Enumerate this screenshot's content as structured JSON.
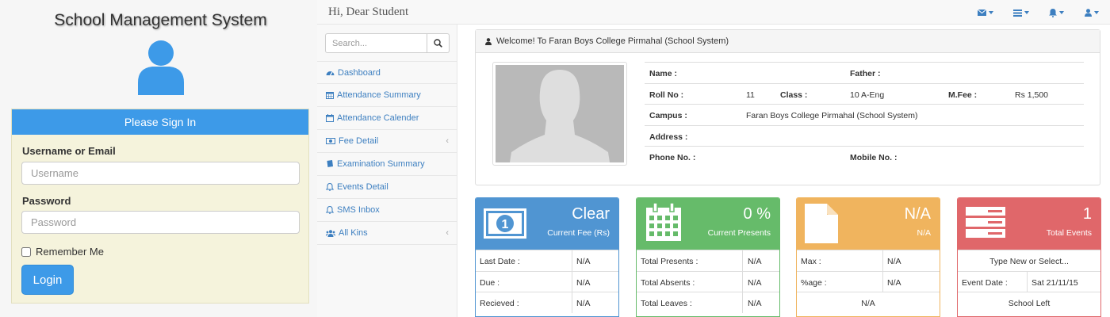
{
  "login": {
    "system_title": "School Management System",
    "panel_title": "Please Sign In",
    "username_label": "Username or Email",
    "username_placeholder": "Username",
    "password_label": "Password",
    "password_placeholder": "Password",
    "remember_label": "Remember Me",
    "login_button": "Login"
  },
  "topbar": {
    "greeting": "Hi, Dear Student",
    "icons": [
      "envelope-icon",
      "tasks-icon",
      "bell-icon",
      "user-icon"
    ]
  },
  "sidebar": {
    "search_placeholder": "Search...",
    "items": [
      {
        "label": "Dashboard",
        "icon": "dashboard-icon",
        "has_submenu": false
      },
      {
        "label": "Attendance Summary",
        "icon": "calendar-icon",
        "has_submenu": false
      },
      {
        "label": "Attendance Calender",
        "icon": "calendar-icon",
        "has_submenu": false
      },
      {
        "label": "Fee Detail",
        "icon": "money-icon",
        "has_submenu": true
      },
      {
        "label": "Examination Summary",
        "icon": "book-icon",
        "has_submenu": false
      },
      {
        "label": "Events Detail",
        "icon": "bell-icon",
        "has_submenu": false
      },
      {
        "label": "SMS Inbox",
        "icon": "bell-icon",
        "has_submenu": false
      },
      {
        "label": "All Kins",
        "icon": "users-icon",
        "has_submenu": true
      }
    ]
  },
  "welcome": {
    "heading": "Welcome! To Faran Boys College Pirmahal (School System)",
    "name_label": "Name :",
    "name_value": "",
    "father_label": "Father :",
    "father_value": "",
    "rollno_label": "Roll No :",
    "rollno_value": "11",
    "class_label": "Class :",
    "class_value": "10 A-Eng",
    "mfee_label": "M.Fee :",
    "mfee_value": "Rs 1,500",
    "campus_label": "Campus :",
    "campus_value": "Faran Boys College Pirmahal (School System)",
    "address_label": "Address :",
    "address_value": "",
    "phone_label": "Phone No. :",
    "phone_value": "",
    "mobile_label": "Mobile No. :",
    "mobile_value": ""
  },
  "cards": {
    "fee": {
      "color": "#5095d2",
      "big": "Clear",
      "sub": "Current Fee (Rs)",
      "rows": [
        {
          "label": "Last Date :",
          "value": "N/A"
        },
        {
          "label": "Due :",
          "value": "N/A"
        },
        {
          "label": "Recieved :",
          "value": "N/A"
        }
      ]
    },
    "attendance": {
      "color": "#66bb6a",
      "big": "0 %",
      "sub": "Current Presents",
      "rows": [
        {
          "label": "Total Presents :",
          "value": "N/A"
        },
        {
          "label": "Total Absents :",
          "value": "N/A"
        },
        {
          "label": "Total Leaves :",
          "value": "N/A"
        }
      ]
    },
    "exam": {
      "color": "#f0b45e",
      "big": "N/A",
      "sub": "N/A",
      "rows": [
        {
          "label": "Max :",
          "value": "N/A"
        },
        {
          "label": "%age :",
          "value": "N/A"
        }
      ],
      "footer": "N/A"
    },
    "events": {
      "color": "#e0676a",
      "big": "1",
      "sub": "Total Events",
      "select_placeholder": "Type New or Select...",
      "rows": [
        {
          "label": "Event Date :",
          "value": "Sat 21/11/15"
        }
      ],
      "footer": "School Left"
    }
  },
  "colors": {
    "primary": "#3d9ae8",
    "link": "#3d7fc0",
    "login_bg": "#f5f3dc"
  }
}
